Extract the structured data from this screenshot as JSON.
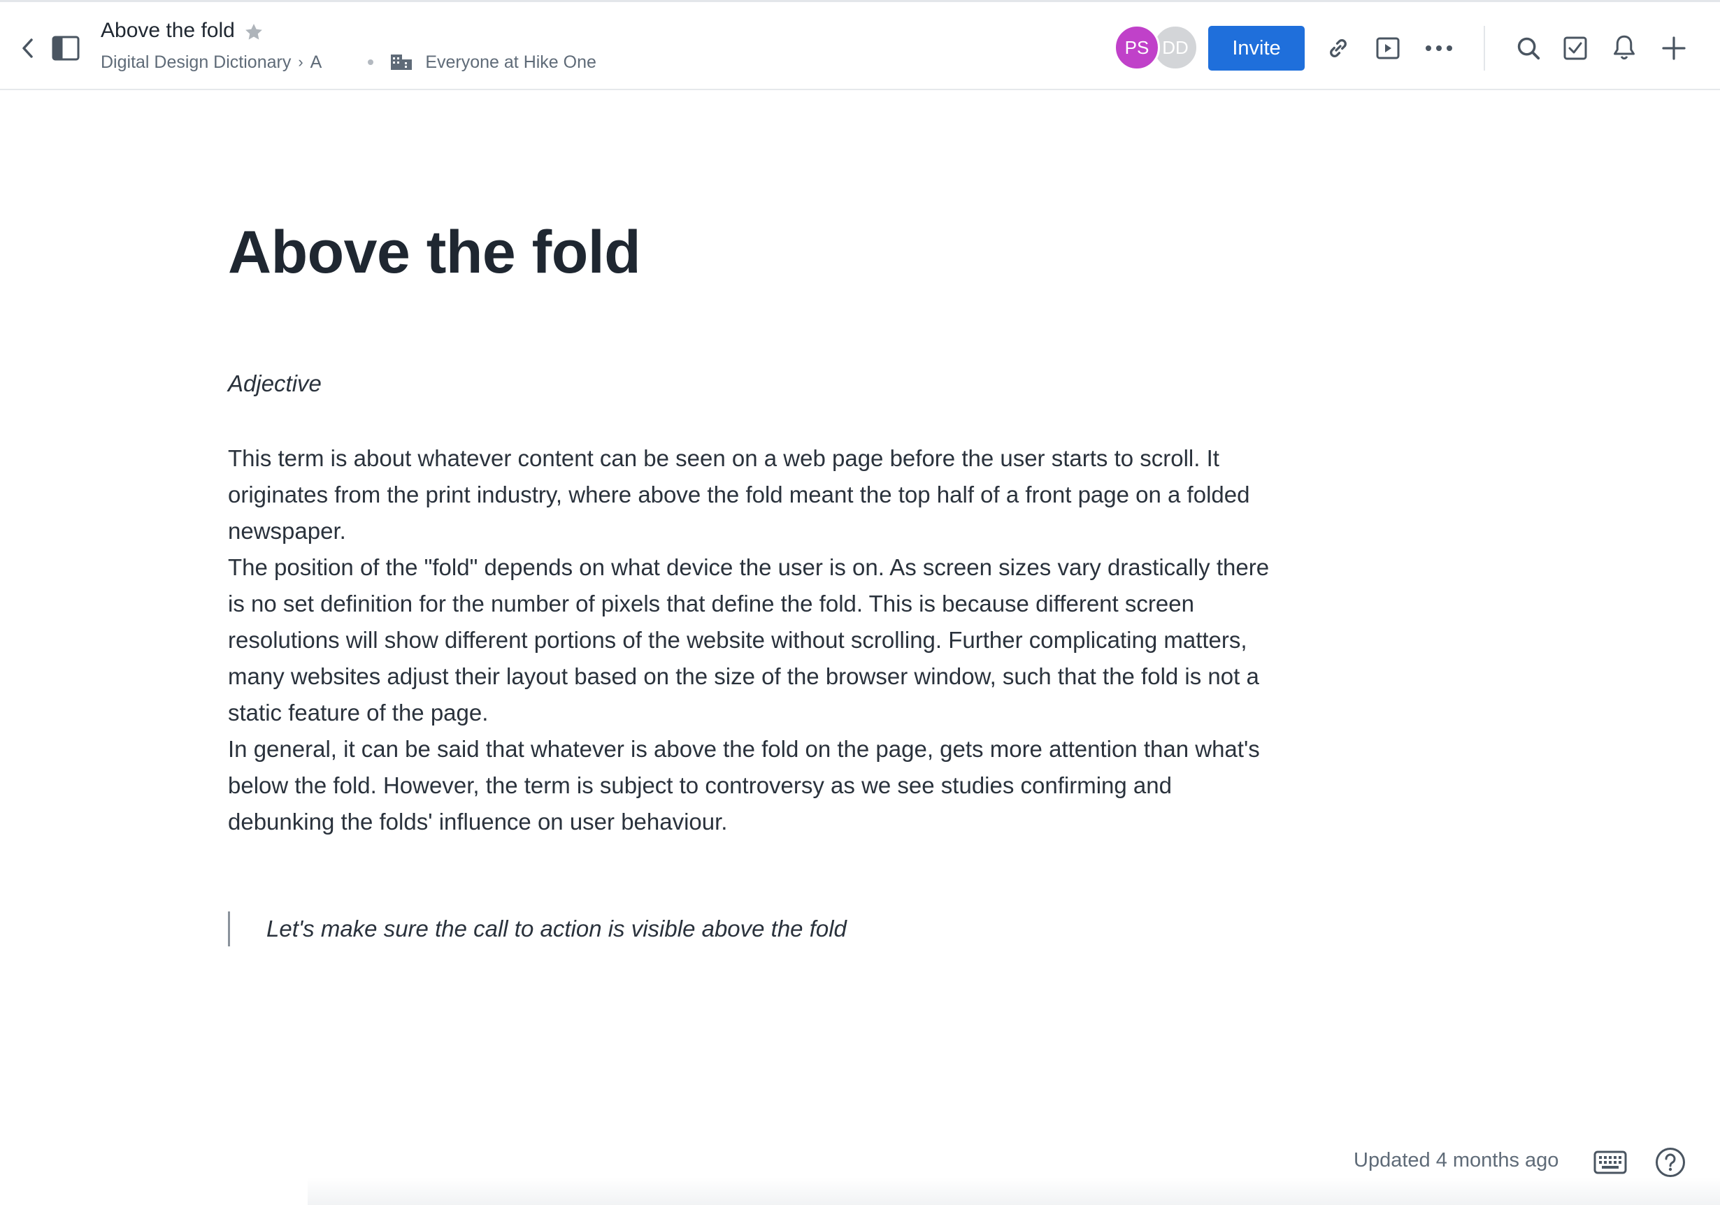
{
  "header": {
    "doc_title": "Above the fold",
    "breadcrumb": {
      "workspace": "Digital Design Dictionary",
      "section": "A",
      "sharing": "Everyone at Hike One"
    },
    "avatars": [
      {
        "initials": "PS",
        "color": "#c041c9"
      },
      {
        "initials": "DD",
        "color": "#d3d5d8"
      }
    ],
    "invite_label": "Invite",
    "icons": [
      "back-icon",
      "sidebar-toggle-icon",
      "star-icon",
      "link-icon",
      "present-icon",
      "more-icon",
      "search-icon",
      "tasks-icon",
      "notifications-icon",
      "add-icon"
    ]
  },
  "document": {
    "title": "Above the fold",
    "part_of_speech": "Adjective",
    "paragraphs": [
      "This term is about whatever content can be seen on a web page before the user starts to scroll. It originates from the print industry, where above the fold meant the top half of a front page on a folded newspaper.",
      "The position of the \"fold\" depends on what device the user is on. As screen sizes vary drastically there is no set definition for the number of pixels that define the fold. This is because different screen resolutions will show different portions of the website without scrolling. Further complicating matters, many websites adjust their layout based on the size of the browser window, such that the fold is not a static feature of the page.",
      "In general, it can be said that whatever is above the fold on the page, gets more attention than what's below the fold. However, the term is subject to controversy as we see studies confirming and debunking the folds' influence on user behaviour."
    ],
    "example_quote": "Let's make sure the call to action is visible above the fold"
  },
  "footer": {
    "updated": "Updated 4 months ago",
    "icons": [
      "keyboard-icon",
      "help-icon"
    ]
  },
  "colors": {
    "accent": "#1f6fdb",
    "text": "#1f2731",
    "muted": "#5f6b78"
  }
}
